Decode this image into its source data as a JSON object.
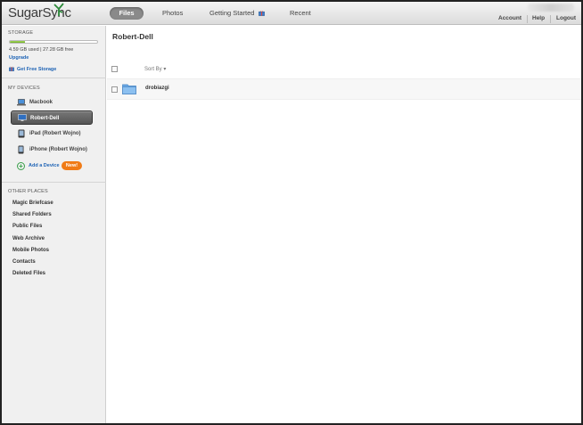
{
  "app": {
    "logo_text": "SugarSync"
  },
  "nav": {
    "tabs": [
      {
        "label": "Files",
        "active": true
      },
      {
        "label": "Photos",
        "active": false
      },
      {
        "label": "Getting Started",
        "active": false
      },
      {
        "label": "Recent",
        "active": false
      }
    ]
  },
  "toplinks": {
    "account": "Account",
    "help": "Help",
    "logout": "Logout"
  },
  "sidebar": {
    "storage": {
      "heading": "STORAGE",
      "used_fraction": 0.17,
      "text": "4.59 GB used | 27.28 GB free",
      "upgrade": "Upgrade",
      "free_storage": "Get Free Storage"
    },
    "devices": {
      "heading": "MY DEVICES",
      "items": [
        {
          "label": "Macbook",
          "icon": "laptop-icon",
          "selected": false
        },
        {
          "label": "Robert-Dell",
          "icon": "computer-icon",
          "selected": true
        },
        {
          "label": "iPad (Robert Wojno)",
          "icon": "tablet-icon",
          "selected": false
        },
        {
          "label": "iPhone (Robert Wojno)",
          "icon": "phone-icon",
          "selected": false
        }
      ],
      "add_device": "Add a Device",
      "new_badge": "New!"
    },
    "other_places": {
      "heading": "OTHER PLACES",
      "items": [
        "Magic Briefcase",
        "Shared Folders",
        "Public Files",
        "Web Archive",
        "Mobile Photos",
        "Contacts",
        "Deleted Files"
      ]
    }
  },
  "main": {
    "title": "Robert-Dell",
    "sort_by": "Sort By ▾",
    "files": [
      {
        "name": "drobiazgi",
        "type": "folder"
      }
    ]
  },
  "colors": {
    "accent_blue": "#1e63b5",
    "badge_orange": "#f07b16",
    "storage_green": "#7fbf2f",
    "selected_device": "#5a5a5a"
  }
}
